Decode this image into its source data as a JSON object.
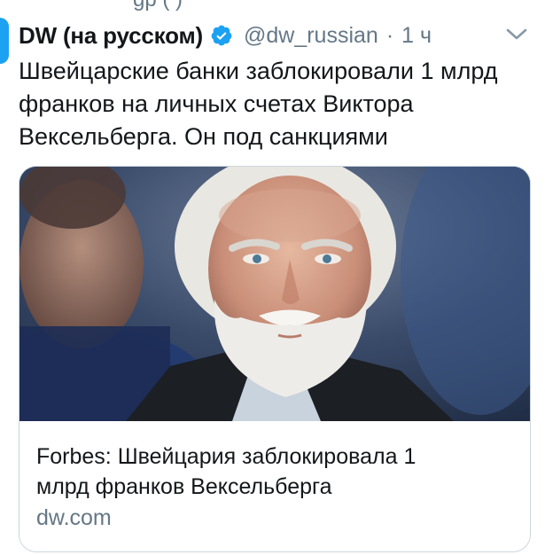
{
  "previous_tweet_fragment": "gp (   )",
  "tweet": {
    "author": {
      "display_name": "DW (на русском)",
      "handle": "@dw_russian",
      "verified": true
    },
    "separator": "·",
    "timestamp": "1 ч",
    "text_lines": [
      "Швейцарские банки заблокировали 1 млрд",
      "франков на личных счетах Виктора",
      "Вексельберга. Он под санкциями"
    ]
  },
  "link_card": {
    "image_description_icon": "news-photo",
    "title_lines": [
      "Forbes: Швейцария заблокировала 1",
      "млрд франков Вексельберга"
    ],
    "domain": "dw.com"
  },
  "colors": {
    "primary_text": "#14171a",
    "secondary_text": "#657786",
    "verified_blue": "#1da1f2",
    "card_border": "#ccd6dd"
  }
}
